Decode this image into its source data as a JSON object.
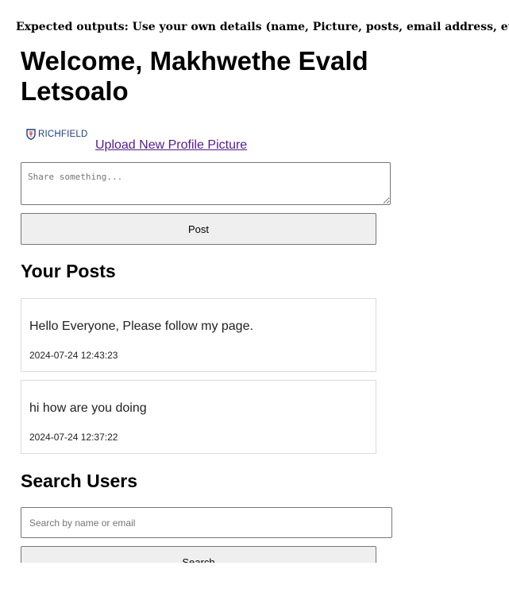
{
  "caption": "Expected outputs: Use your own details (name, Picture, posts, email address, etc)",
  "header": {
    "welcome": "Welcome, Makhwethe Evald Letsoalo"
  },
  "profile": {
    "logo_text": "RICHFIELD",
    "upload_link": "Upload New Profile Picture"
  },
  "composer": {
    "placeholder": "Share something...",
    "post_label": "Post"
  },
  "posts_section": {
    "heading": "Your Posts",
    "items": [
      {
        "text": "Hello Everyone, Please follow my page.",
        "timestamp": "2024-07-24 12:43:23"
      },
      {
        "text": "hi how are you doing",
        "timestamp": "2024-07-24 12:37:22"
      }
    ]
  },
  "search_section": {
    "heading": "Search Users",
    "placeholder": "Search by name or email",
    "button_label": "Search"
  },
  "colors": {
    "link": "#551a8b",
    "logo": "#1f3d7a",
    "button_bg": "#efefef"
  }
}
